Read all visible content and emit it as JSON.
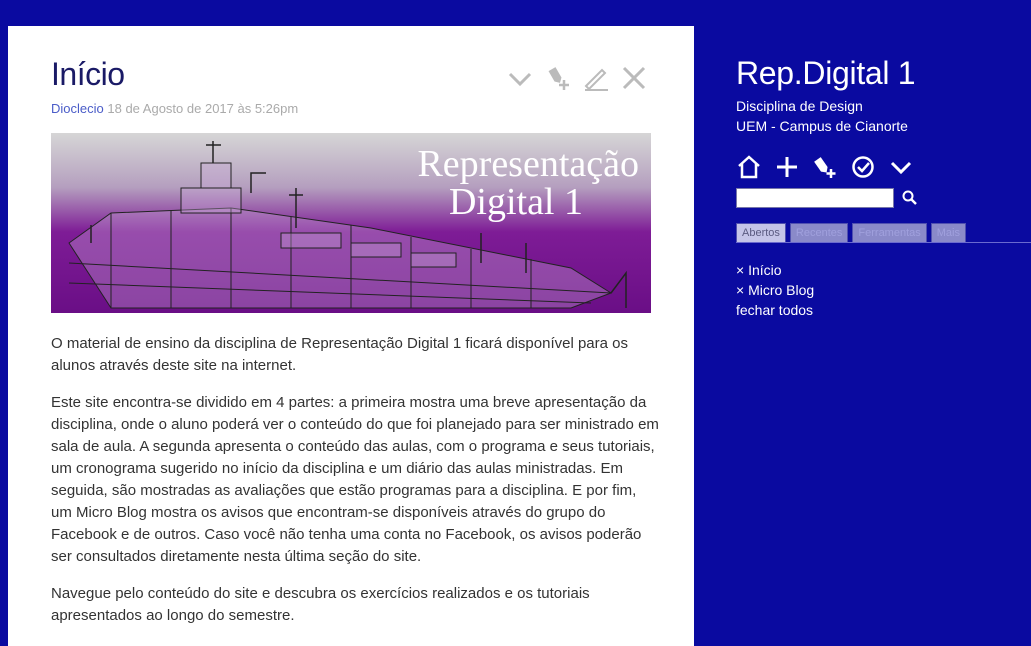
{
  "tiddler": {
    "title": "Início",
    "author": "Dioclecio",
    "date": "18 de Agosto de 2017 às 5:26pm",
    "banner": {
      "line1": "Representação",
      "line2": "Digital 1"
    },
    "paragraphs": [
      "O material de ensino da disciplina de Representação Digital 1 ficará disponível para os alunos através deste site na internet.",
      "Este site encontra-se dividido em 4 partes: a primeira mostra uma breve apresentação da disciplina, onde o aluno poderá ver o conteúdo do que foi planejado para ser ministrado em sala de aula. A segunda apresenta o conteúdo das aulas, com o programa e seus tutoriais, um cronograma sugerido no início da disciplina e um diário das aulas ministradas. Em seguida, são mostradas as avaliações que estão programas para a disciplina. E por fim, um Micro Blog mostra os avisos que encontram-se disponíveis através do grupo do Facebook e de outros. Caso você não tenha uma conta no Facebook, os avisos poderão ser consultados diretamente nesta última seção do site.",
      "Navegue pelo conteúdo do site e descubra os exercícios realizados e os tutoriais apresentados ao longo do semestre."
    ],
    "tool_icons": [
      "chevron-down-icon",
      "tag-plus-icon",
      "pencil-icon",
      "close-icon"
    ]
  },
  "sidebar": {
    "site_title": "Rep.Digital 1",
    "subtitle_line1": "Disciplina de Design",
    "subtitle_line2": "UEM - Campus de Cianorte",
    "tool_icons": [
      "home-icon",
      "plus-icon",
      "tag-icon",
      "check-circle-icon",
      "chevron-down-icon"
    ],
    "search": {
      "value": ""
    },
    "tabs": [
      {
        "label": "Abertos",
        "active": true
      },
      {
        "label": "Recentes",
        "active": false
      },
      {
        "label": "Ferramentas",
        "active": false
      },
      {
        "label": "Mais",
        "active": false
      }
    ],
    "open_items": [
      "× Início",
      "× Micro Blog"
    ],
    "close_all": "fechar todos"
  },
  "colors": {
    "background": "#0a0aa0",
    "card": "#ffffff",
    "link": "#4a5cc8"
  }
}
